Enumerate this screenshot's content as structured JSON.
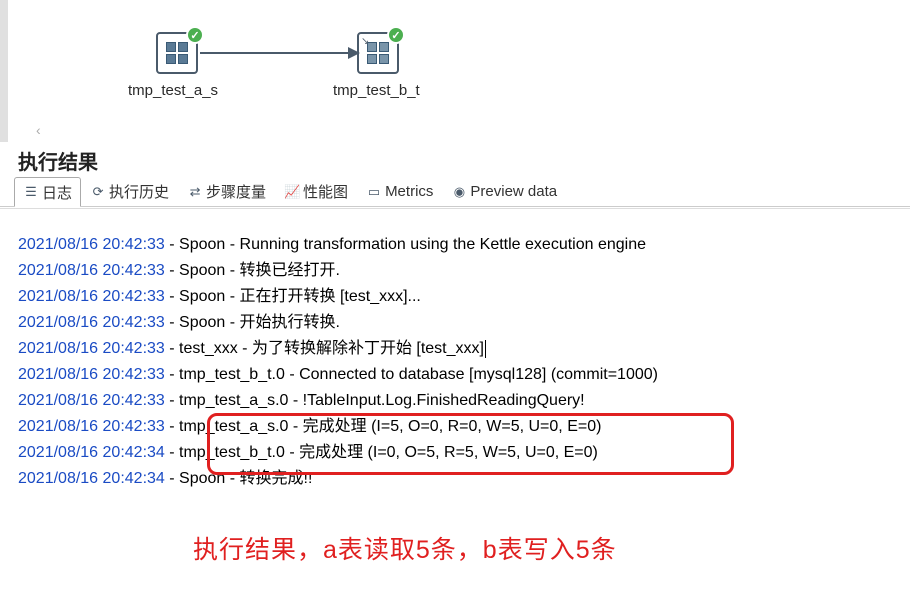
{
  "canvas": {
    "step_a_label": "tmp_test_a_s",
    "step_b_label": "tmp_test_b_t"
  },
  "panel": {
    "title": "执行结果"
  },
  "tabs": {
    "log": "日志",
    "history": "执行历史",
    "metrics_step": "步骤度量",
    "perf": "性能图",
    "metrics": "Metrics",
    "preview": "Preview data"
  },
  "log": [
    {
      "ts": "2021/08/16 20:42:33",
      "msg": " - Spoon - Running transformation using the Kettle execution engine"
    },
    {
      "ts": "2021/08/16 20:42:33",
      "msg": " - Spoon - 转换已经打开."
    },
    {
      "ts": "2021/08/16 20:42:33",
      "msg": " - Spoon - 正在打开转换 [test_xxx]..."
    },
    {
      "ts": "2021/08/16 20:42:33",
      "msg": " - Spoon - 开始执行转换."
    },
    {
      "ts": "2021/08/16 20:42:33",
      "msg": " - test_xxx - 为了转换解除补丁开始  [test_xxx]"
    },
    {
      "ts": "2021/08/16 20:42:33",
      "msg": " - tmp_test_b_t.0 - Connected to database [mysql128] (commit=1000)"
    },
    {
      "ts": "2021/08/16 20:42:33",
      "msg": " - tmp_test_a_s.0 - !TableInput.Log.FinishedReadingQuery!"
    },
    {
      "ts": "2021/08/16 20:42:33",
      "msg": " - tmp_test_a_s.0 - 完成处理 (I=5, O=0, R=0, W=5, U=0, E=0)"
    },
    {
      "ts": "2021/08/16 20:42:34",
      "msg": " - tmp_test_b_t.0 - 完成处理 (I=0, O=5, R=5, W=5, U=0, E=0)"
    },
    {
      "ts": "2021/08/16 20:42:34",
      "msg": " - Spoon - 转换完成!!"
    }
  ],
  "annotation": "执行结果，a表读取5条，b表写入5条"
}
